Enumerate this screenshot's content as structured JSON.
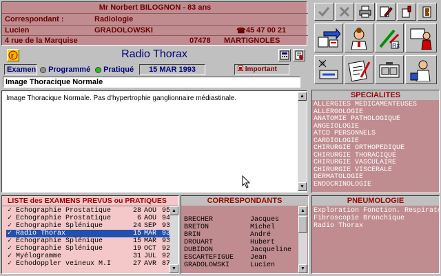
{
  "patient": {
    "name_line": "Mr Norbert BILOGNON - 83 ans",
    "correspondant_label": "Correspondant :",
    "correspondant_value": "Radiologie",
    "contact_first": "Lucien",
    "contact_last": "GRADOLOWSKI",
    "phone": "45 47 00 21",
    "address": "4 rue de la Marquise",
    "zip": "07478",
    "city": "MARTIGNOLES"
  },
  "exam": {
    "title": "Radio Thorax",
    "label": "Examen",
    "option_planned": "Programmé",
    "option_done": "Pratiqué",
    "date": "15 MAR 1993",
    "important_label": "Important",
    "summary": "Image Thoracique Normale",
    "notes": "Image Thoracique Normale. Pas d'hypertrophie ganglionnaire médiastinale."
  },
  "specialites": {
    "title": "SPECIALITES",
    "items": [
      "ALLERGIES MEDICAMENTEUSES",
      "ALLERGOLOGIE",
      "ANATOMIE PATHOLOGIQUE",
      "ANGEIOLOGIE",
      "ATCD PERSONNELS",
      "CARDIOLOGIE",
      "CHIRURGIE ORTHOPEDIQUE",
      "CHIRURGIE THORACIQUE",
      "CHIRURGIE VASCULAIRE",
      "CHIRURGIE VISCERALE",
      "DERMATOLOGIE",
      "ENDOCRINOLOGIE"
    ]
  },
  "exams_list": {
    "title": "LISTE des EXAMENS PREVUS ou PRATIQUES",
    "items": [
      {
        "mark": "✓",
        "name": "Echographie Prostatique",
        "day": "28",
        "month": "AOU",
        "year": "95"
      },
      {
        "mark": "✓",
        "name": "Echographie Prostatique",
        "day": "6",
        "month": "AOU",
        "year": "94"
      },
      {
        "mark": "✓",
        "name": "Echographie Splénique",
        "day": "24",
        "month": "SEP",
        "year": "93"
      },
      {
        "mark": "✓",
        "name": "Radio Thorax",
        "day": "15",
        "month": "MAR",
        "year": "93"
      },
      {
        "mark": "✓",
        "name": "Echographie Splénique",
        "day": "15",
        "month": "MAR",
        "year": "93"
      },
      {
        "mark": "✓",
        "name": "Echographie Splénique",
        "day": "19",
        "month": "OCT",
        "year": "92"
      },
      {
        "mark": "✓",
        "name": "Myélogramme",
        "day": "31",
        "month": "JUL",
        "year": "92"
      },
      {
        "mark": "✓",
        "name": "Echodoppler veineux M.I",
        "day": "27",
        "month": "AVR",
        "year": "87"
      }
    ]
  },
  "correspondants": {
    "title": "CORRESPONDANTS",
    "items": [
      {
        "last": "BRECHER",
        "first": "Jacques"
      },
      {
        "last": "BRETON",
        "first": "Michel"
      },
      {
        "last": "BRIN",
        "first": "André"
      },
      {
        "last": "DROUART",
        "first": "Hubert"
      },
      {
        "last": "DUBIDON",
        "first": "Jacqueline"
      },
      {
        "last": "ESCARTEFIGUE",
        "first": "Jean"
      },
      {
        "last": "GRADOLOWSKI",
        "first": "Lucien"
      }
    ]
  },
  "pneumologie": {
    "title": "PNEUMOLOGIE",
    "items": [
      "Exploration Fonction. Respiratoire",
      "Fibroscopie Bronchique",
      "Radio Thorax"
    ]
  },
  "colors": {
    "panel_rose": "#c08c90",
    "list_pink": "#f4c8c8",
    "selected": "#2050b0",
    "title_red": "#a00000"
  }
}
